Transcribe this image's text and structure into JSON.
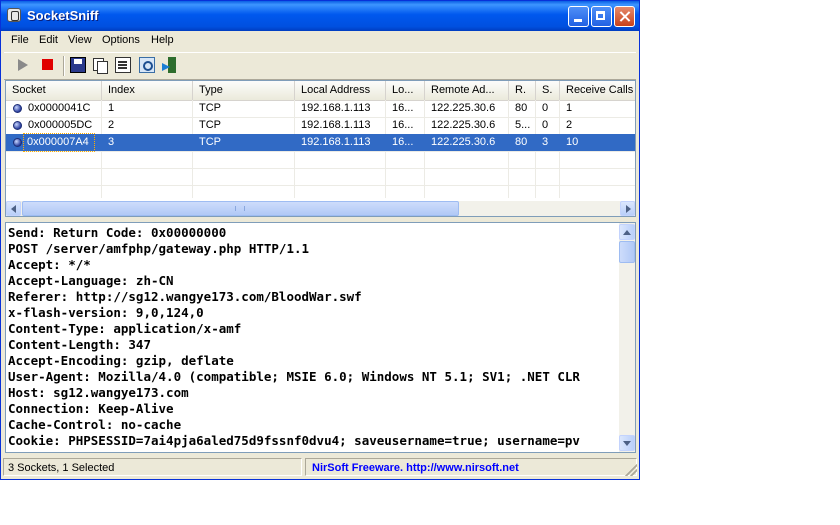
{
  "window": {
    "title": "SocketSniff"
  },
  "menu": [
    "File",
    "Edit",
    "View",
    "Options",
    "Help"
  ],
  "toolbar": {
    "icons": [
      "play-icon",
      "stop-icon",
      "save-icon",
      "copy-icon",
      "properties-icon",
      "find-icon",
      "exit-icon"
    ]
  },
  "socket_list": {
    "columns": [
      "Socket",
      "Index",
      "Type",
      "Local Address",
      "Lo...",
      "Remote Ad...",
      "R.",
      "S.",
      "Receive Calls"
    ],
    "rows": [
      {
        "socket": "0x0000041C",
        "index": "1",
        "type": "TCP",
        "local_address": "192.168.1.113",
        "local_port": "16...",
        "remote_address": "122.225.30.6",
        "remote_port": "80",
        "send": "0",
        "receive_calls": "1",
        "selected": false
      },
      {
        "socket": "0x000005DC",
        "index": "2",
        "type": "TCP",
        "local_address": "192.168.1.113",
        "local_port": "16...",
        "remote_address": "122.225.30.6",
        "remote_port": "5...",
        "send": "0",
        "receive_calls": "2",
        "selected": false
      },
      {
        "socket": "0x000007A4",
        "index": "3",
        "type": "TCP",
        "local_address": "192.168.1.113",
        "local_port": "16...",
        "remote_address": "122.225.30.6",
        "remote_port": "80",
        "send": "3",
        "receive_calls": "10",
        "selected": true
      }
    ]
  },
  "details": {
    "lines": [
      "Send: Return Code: 0x00000000",
      "POST /server/amfphp/gateway.php HTTP/1.1",
      "Accept: */*",
      "Accept-Language: zh-CN",
      "Referer: http://sg12.wangye173.com/BloodWar.swf",
      "x-flash-version: 9,0,124,0",
      "Content-Type: application/x-amf",
      "Content-Length: 347",
      "Accept-Encoding: gzip, deflate",
      "User-Agent: Mozilla/4.0 (compatible; MSIE 6.0; Windows NT 5.1; SV1; .NET CLR",
      "Host: sg12.wangye173.com",
      "Connection: Keep-Alive",
      "Cache-Control: no-cache",
      "Cookie: PHPSESSID=7ai4pja6aled75d9fssnf0dvu4; saveusername=true; username=pv"
    ]
  },
  "status": {
    "left": "3 Sockets, 1 Selected",
    "right": "NirSoft Freeware.  http://www.nirsoft.net"
  },
  "colors": {
    "titlebar": "#0058ee",
    "selection": "#316ac5",
    "link": "#0000ff",
    "stop": "#e00000"
  }
}
